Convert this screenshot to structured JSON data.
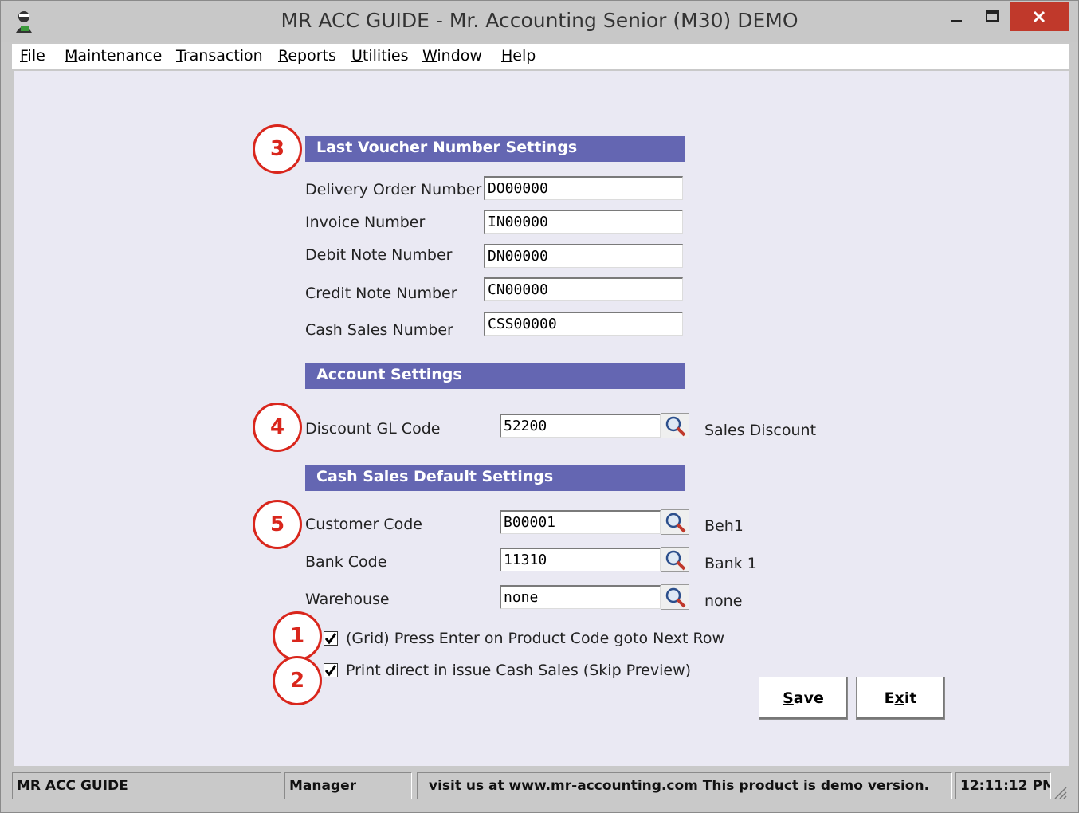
{
  "window": {
    "title": "MR ACC GUIDE - Mr. Accounting Senior (M30) DEMO"
  },
  "menu": [
    {
      "accel": "F",
      "rest": "ile"
    },
    {
      "accel": "M",
      "rest": "aintenance"
    },
    {
      "accel": "T",
      "rest": "ransaction"
    },
    {
      "accel": "R",
      "rest": "eports"
    },
    {
      "accel": "U",
      "rest": "tilities"
    },
    {
      "accel": "W",
      "rest": "indow"
    },
    {
      "accel": "H",
      "rest": "elp"
    }
  ],
  "voucher": {
    "header": "Last Voucher Number Settings",
    "fields": [
      {
        "label": "Delivery Order Number",
        "value": "DO00000"
      },
      {
        "label": "Invoice Number",
        "value": "IN00000"
      },
      {
        "label": "Debit Note Number",
        "value": "DN00000"
      },
      {
        "label": "Credit Note Number",
        "value": "CN00000"
      },
      {
        "label": "Cash Sales Number",
        "value": "CSS00000"
      }
    ]
  },
  "account": {
    "header": "Account Settings",
    "discount_label": "Discount GL Code",
    "discount_value": "52200",
    "discount_desc": "Sales Discount"
  },
  "cash_sales": {
    "header": "Cash Sales Default Settings",
    "fields": [
      {
        "label": "Customer Code",
        "value": "B00001",
        "desc": "Beh1"
      },
      {
        "label": "Bank Code",
        "value": "11310",
        "desc": "Bank 1"
      },
      {
        "label": "Warehouse",
        "value": "none",
        "desc": "none"
      }
    ]
  },
  "options": [
    {
      "label": "(Grid) Press Enter on Product Code goto Next Row",
      "checked": true
    },
    {
      "label": "Print direct in issue Cash Sales (Skip Preview)",
      "checked": true
    }
  ],
  "callouts": [
    "3",
    "4",
    "5",
    "1",
    "2"
  ],
  "buttons": {
    "save": {
      "accel": "S",
      "rest": "ave"
    },
    "exit": {
      "pre": "E",
      "accel": "x",
      "rest": "it"
    }
  },
  "status": {
    "app": "MR ACC GUIDE",
    "user": "Manager",
    "message": "visit us at www.mr-accounting.com This product is demo version.",
    "time": "12:11:12 PM"
  },
  "colors": {
    "section_header": "#6466b2",
    "client_bg": "#eae9f3",
    "callout": "#d9261c",
    "close_button": "#c0392b"
  }
}
